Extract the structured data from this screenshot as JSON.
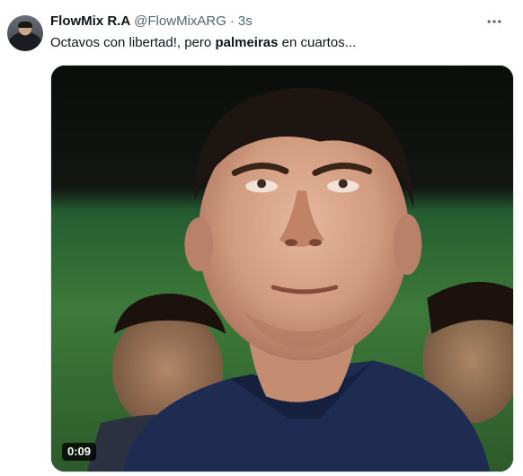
{
  "author": {
    "name": "FlowMix R.A",
    "handle": "@FlowMixARG",
    "separator": "·",
    "time": "3s"
  },
  "tweet": {
    "text_part1": "Octavos con libertad!, pero ",
    "text_bold": "palmeiras",
    "text_part2": " en cuartos..."
  },
  "media": {
    "type": "video",
    "duration": "0:09"
  },
  "icons": {
    "more": "more-dots-icon",
    "avatar": "user-avatar"
  },
  "colors": {
    "primary_text": "#0f1419",
    "secondary_text": "#536471",
    "background": "#ffffff"
  }
}
